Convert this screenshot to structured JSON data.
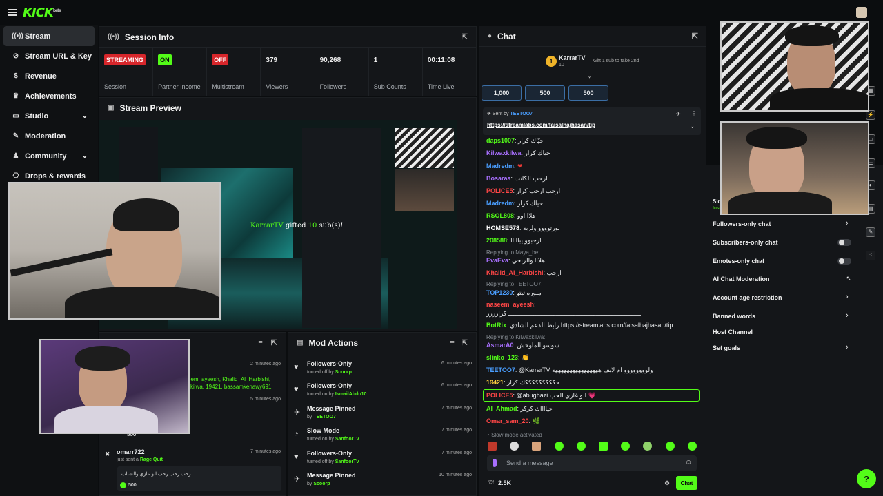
{
  "brand": {
    "logo": "KICK",
    "beta": "beta"
  },
  "sidebar": {
    "items": [
      {
        "label": "Stream",
        "icon": "broadcast-icon",
        "active": true
      },
      {
        "label": "Stream URL & Key",
        "icon": "link-icon"
      },
      {
        "label": "Revenue",
        "icon": "dollar-icon"
      },
      {
        "label": "Achievements",
        "icon": "trophy-icon"
      },
      {
        "label": "Studio",
        "icon": "monitor-icon",
        "expand": true
      },
      {
        "label": "Moderation",
        "icon": "wrench-icon"
      },
      {
        "label": "Community",
        "icon": "users-icon",
        "expand": true
      },
      {
        "label": "Drops & rewards",
        "icon": "gift-icon"
      }
    ]
  },
  "session": {
    "title": "Session Info",
    "stats": [
      {
        "value": "STREAMING",
        "label": "Session"
      },
      {
        "value": "ON",
        "label": "Partner Income"
      },
      {
        "value": "OFF",
        "label": "Multistream"
      },
      {
        "value": "379",
        "label": "Viewers"
      },
      {
        "value": "90,268",
        "label": "Followers"
      },
      {
        "value": "1",
        "label": "Sub Counts"
      },
      {
        "value": "00:11:08",
        "label": "Time Live"
      }
    ]
  },
  "preview": {
    "title": "Stream Preview",
    "gift_user": "KarrarTV",
    "gift_text": "gifted",
    "gift_count": "10",
    "gift_suffix": "sub(s)!"
  },
  "activity": {
    "time1": "2 minutes ago",
    "names": "eem_ayeesh, Khalid_Al_Harbishi,",
    "names2": "kkilwa, 19421, bassamkenawy691",
    "time2": "5 minutes ago",
    "amount1": "500",
    "user": "omarr722",
    "user_time": "7 minutes ago",
    "action": "just sent a",
    "action_link": "Rage Quit",
    "message": "رحب رحب رحب ابو عازي والشباب",
    "amount2": "500"
  },
  "mod_actions": {
    "title": "Mod Actions",
    "items": [
      {
        "title": "Followers-Only",
        "action": "turned off by",
        "user": "Scoorp",
        "time": "6 minutes ago",
        "icon": "heart-icon"
      },
      {
        "title": "Followers-Only",
        "action": "turned on by",
        "user": "IsmailAbdo10",
        "time": "6 minutes ago",
        "icon": "heart-icon"
      },
      {
        "title": "Message Pinned",
        "action": "by",
        "user": "TEETOO7",
        "time": "7 minutes ago",
        "icon": "pin-icon"
      },
      {
        "title": "Slow Mode",
        "action": "turned on by",
        "user": "SanfoorTv",
        "time": "7 minutes ago",
        "icon": "slow-icon"
      },
      {
        "title": "Followers-Only",
        "action": "turned off by",
        "user": "SanfoorTv",
        "time": "7 minutes ago",
        "icon": "heart-icon"
      },
      {
        "title": "Message Pinned",
        "action": "by",
        "user": "Scoorp",
        "time": "10 minutes ago",
        "icon": "pin-icon"
      }
    ]
  },
  "chat": {
    "title": "Chat",
    "top_gifter": "KarrarTV",
    "top_gifter_count": "10",
    "gift_cta": "Gift 1 sub to take 2nd",
    "leaderboard": [
      "1,000",
      "500",
      "500"
    ],
    "pinned_by_label": "Sent by",
    "pinned_by": "TEETOO7",
    "pinned_link": "https://streamlabs.com/faisalhajhasan/tip",
    "messages": [
      {
        "user": "daps1007",
        "color": "#53fc18",
        "text": "حيّاك كرار"
      },
      {
        "user": "Kilwaxkilwa",
        "color": "#a970ff",
        "text": "حياك كرار"
      },
      {
        "user": "Madredm",
        "color": "#4a9eff",
        "text": "❤"
      },
      {
        "user": "Bosaraa",
        "color": "#a970ff",
        "text": "ارحب الكاتب"
      },
      {
        "user": "POLICE5",
        "color": "#ff4646",
        "text": "ارحب ارحب كرار"
      },
      {
        "user": "Madredm",
        "color": "#4a9eff",
        "text": "حياك كرار"
      },
      {
        "user": "RSOL808",
        "color": "#53fc18",
        "text": "هلااااوو"
      },
      {
        "user": "HOMSE578",
        "color": "#ffffff",
        "text": "نورتوووو ولربه"
      },
      {
        "user": "208588",
        "color": "#53fc18",
        "text": "ارحبوو يبااااا"
      },
      {
        "reply": "Replying to Maya_be: ",
        "user": "EvaEva",
        "color": "#a970ff",
        "text": "هلااا والربحي"
      },
      {
        "user": "Khalid_Al_Harbishi",
        "color": "#ff4646",
        "text": "ارحب"
      },
      {
        "reply": "Replying to TEETOO7: ",
        "user": "TOP1230",
        "color": "#4a9eff",
        "text": "منوره تيتو"
      },
      {
        "user": "naseem_ayeesh",
        "color": "#ff4646",
        "text": "ـــــــــــــــــــــــــــــــــــــــــــــــــــــــــــــــــــــــــــــــــــــــــــــــــــ كرارررر"
      },
      {
        "user": "BotRix",
        "color": "#53fc18",
        "text": "رابط الدعم الشادي https://streamlabs.com/faisalhajhasan/tip"
      },
      {
        "reply": "Replying to Kilwaxkilwa: ",
        "user": "AsmarA0",
        "color": "#a970ff",
        "text": "سوسو الماوحش"
      },
      {
        "user": "slinko_123",
        "color": "#53fc18",
        "text": "👏"
      },
      {
        "user": "TEETOO7",
        "color": "#4a9eff",
        "text": "@KarrarTV ولوووووووو ام لايف ههههههههههههههههه"
      },
      {
        "user": "19421",
        "color": "#ffd23f",
        "text": "حكككككككككك كرار"
      },
      {
        "user": "POLICE5",
        "color": "#ff4646",
        "text": "@abughazi ابو غازي الحب 💗"
      },
      {
        "user": "Al_Ahmad",
        "color": "#53fc18",
        "text": "حيااااك كركر"
      },
      {
        "user": "Omar_sam_20",
        "color": "#ff4646",
        "text": "🌿"
      }
    ],
    "slow_mode": "Slow mode activated",
    "input_placeholder": "Send a message",
    "viewers": "2.5K",
    "send_label": "Chat"
  },
  "chat_settings": {
    "items": [
      {
        "label": "Followers-only chat",
        "control": "arrow"
      },
      {
        "label": "Subscribers-only chat",
        "control": "toggle"
      },
      {
        "label": "Emotes-only chat",
        "control": "toggle"
      },
      {
        "label": "AI Chat Moderation",
        "control": "external"
      },
      {
        "label": "Account age restriction",
        "control": "arrow"
      },
      {
        "label": "Banned words",
        "control": "arrow"
      },
      {
        "label": "Host Channel",
        "control": "none"
      },
      {
        "label": "Set goals",
        "control": "arrow"
      }
    ],
    "partial_label": "Slo",
    "partial_label2": "Insi"
  }
}
